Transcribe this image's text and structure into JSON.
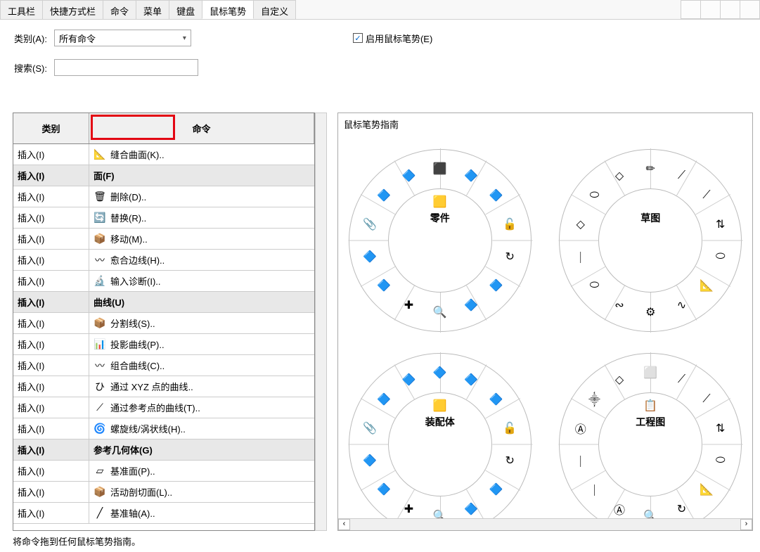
{
  "tabs": [
    "工具栏",
    "快捷方式栏",
    "命令",
    "菜单",
    "键盘",
    "鼠标笔势",
    "自定义"
  ],
  "active_tab": 5,
  "category_label": "类别(A):",
  "category_value": "所有命令",
  "enable_checkbox_label": "启用鼠标笔势(E)",
  "enable_checked": true,
  "search_label": "搜索(S):",
  "table": {
    "header_cat": "类别",
    "header_cmd": "命令",
    "rows": [
      {
        "cat": "插入(I)",
        "cmd": "缝合曲面(K)..",
        "icon": "📐",
        "group": false
      },
      {
        "cat": "插入(I)",
        "cmd": "面(F)",
        "icon": "",
        "group": true
      },
      {
        "cat": "插入(I)",
        "cmd": "删除(D)..",
        "icon": "🗑",
        "group": false
      },
      {
        "cat": "插入(I)",
        "cmd": "替换(R)..",
        "icon": "🔄",
        "group": false
      },
      {
        "cat": "插入(I)",
        "cmd": "移动(M)..",
        "icon": "📦",
        "group": false
      },
      {
        "cat": "插入(I)",
        "cmd": "愈合边线(H)..",
        "icon": "〰",
        "group": false
      },
      {
        "cat": "插入(I)",
        "cmd": "输入诊断(I)..",
        "icon": "🔬",
        "group": false
      },
      {
        "cat": "插入(I)",
        "cmd": "曲线(U)",
        "icon": "",
        "group": true
      },
      {
        "cat": "插入(I)",
        "cmd": "分割线(S)..",
        "icon": "📦",
        "group": false
      },
      {
        "cat": "插入(I)",
        "cmd": "投影曲线(P)..",
        "icon": "📊",
        "group": false
      },
      {
        "cat": "插入(I)",
        "cmd": "组合曲线(C)..",
        "icon": "〰",
        "group": false
      },
      {
        "cat": "插入(I)",
        "cmd": "通过 XYZ 点的曲线..",
        "icon": "ひ",
        "group": false
      },
      {
        "cat": "插入(I)",
        "cmd": "通过参考点的曲线(T)..",
        "icon": "⟋",
        "group": false
      },
      {
        "cat": "插入(I)",
        "cmd": "螺旋线/涡状线(H)..",
        "icon": "🌀",
        "group": false
      },
      {
        "cat": "插入(I)",
        "cmd": "参考几何体(G)",
        "icon": "",
        "group": true
      },
      {
        "cat": "插入(I)",
        "cmd": "基准面(P)..",
        "icon": "▱",
        "group": false
      },
      {
        "cat": "插入(I)",
        "cmd": "活动剖切面(L)..",
        "icon": "📦",
        "group": false
      },
      {
        "cat": "插入(I)",
        "cmd": "基准轴(A)..",
        "icon": "╱",
        "group": false
      }
    ]
  },
  "guide_title": "鼠标笔势指南",
  "wheels": [
    {
      "label": "零件",
      "center_icon": "🟨",
      "icons": [
        "⬛",
        "🔷",
        "🔷",
        "🔓",
        "↻",
        "🔷",
        "🔷",
        "🔍",
        "✚",
        "🔷",
        "🔷",
        "📎",
        "🔷",
        "🔷"
      ]
    },
    {
      "label": "草图",
      "center_icon": "",
      "icons": [
        "✏",
        "⟋",
        "⟋",
        "⇅",
        "⬭",
        "📐",
        "∿",
        "⚙",
        "∾",
        "⬭",
        "｜",
        "◇",
        "⬭",
        "◇"
      ]
    },
    {
      "label": "装配体",
      "center_icon": "🟨",
      "icons": [
        "🔷",
        "🔷",
        "🔷",
        "🔓",
        "↻",
        "🔷",
        "🔷",
        "🔍",
        "✚",
        "🔷",
        "🔷",
        "📎",
        "🔷",
        "🔷"
      ]
    },
    {
      "label": "工程图",
      "center_icon": "📋",
      "icons": [
        "⬜",
        "⟋",
        "⟋",
        "⇅",
        "⬭",
        "📐",
        "↻",
        "🔍",
        "Ⓐ",
        "｜",
        "｜",
        "Ⓐ",
        "⸎",
        "◇"
      ]
    }
  ],
  "footer": "将命令拖到任何鼠标笔势指南。"
}
